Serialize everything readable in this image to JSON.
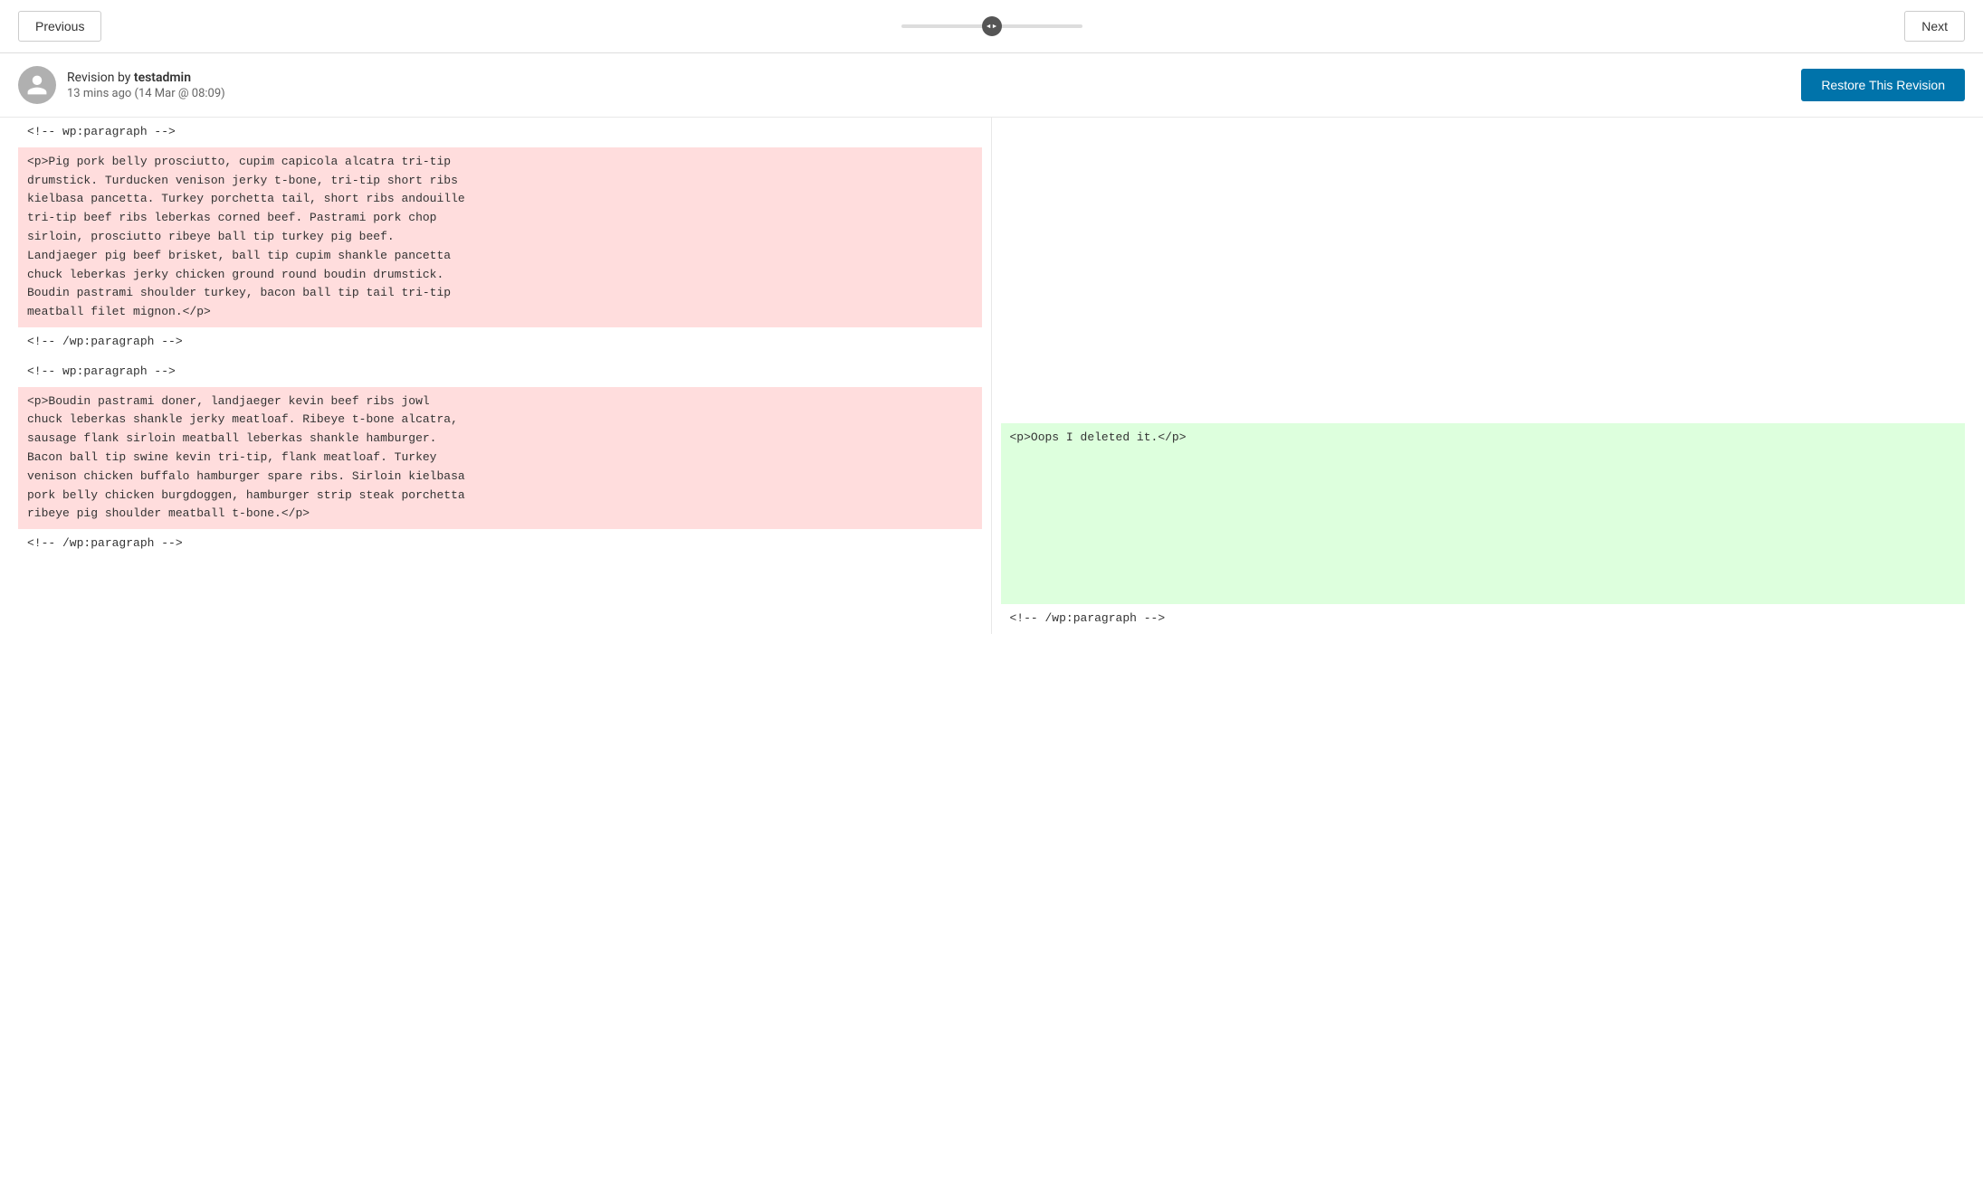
{
  "nav": {
    "prev_label": "Previous",
    "next_label": "Next"
  },
  "revision": {
    "author_prefix": "Revision by ",
    "author": "testadmin",
    "time": "13 mins ago (14 Mar @ 08:09)",
    "restore_label": "Restore This Revision"
  },
  "diff": {
    "left": [
      {
        "type": "comment",
        "text": "<!-- wp:paragraph -->"
      },
      {
        "type": "removed",
        "text": "<p>Pig pork belly prosciutto, cupim capicola alcatra tri-tip drumstick. Turducken venison jerky t-bone, tri-tip short ribs kielbasa pancetta. Turkey porchetta tail, short ribs andouille tri-tip beef ribs leberkas corned beef. Pastrami pork chop sirloin, prosciutto ribeye ball tip turkey pig beef. Landjaeger pig beef brisket, ball tip cupim shankle pancetta chuck leberkas jerky chicken ground round boudin drumstick. Boudin pastrami shoulder turkey, bacon ball tip tail tri-tip meatball filet mignon.</p>"
      },
      {
        "type": "comment",
        "text": "<!-- /wp:paragraph -->"
      },
      {
        "type": "comment",
        "text": "<!-- wp:paragraph -->"
      },
      {
        "type": "removed",
        "text": "<p>Boudin pastrami doner, landjaeger kevin beef ribs jowl chuck leberkas shankle jerky meatloaf. Ribeye t-bone alcatra, sausage flank sirloin meatball leberkas shankle hamburger. Bacon ball tip swine kevin tri-tip, flank meatloaf. Turkey venison chicken buffalo hamburger spare ribs. Sirloin kielbasa pork belly chicken burgdoggen, hamburger strip steak porchetta ribeye pig shoulder meatball t-bone.</p>"
      },
      {
        "type": "comment",
        "text": "<!-- /wp:paragraph -->"
      }
    ],
    "right": [
      {
        "type": "empty",
        "text": ""
      },
      {
        "type": "empty",
        "text": ""
      },
      {
        "type": "empty",
        "text": ""
      },
      {
        "type": "empty",
        "text": ""
      },
      {
        "type": "added",
        "text": "<p>Oops I deleted it.</p>"
      },
      {
        "type": "comment",
        "text": "<!-- /wp:paragraph -->"
      }
    ]
  }
}
